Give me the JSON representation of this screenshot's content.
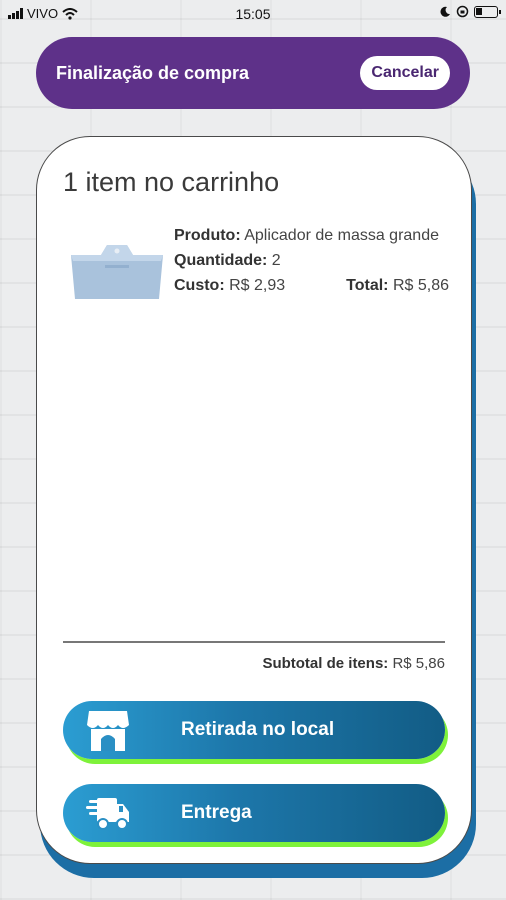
{
  "status_bar": {
    "carrier": "VIVO",
    "time": "15:05"
  },
  "header": {
    "title": "Finalização de compra",
    "cancel_label": "Cancelar"
  },
  "cart": {
    "title": "1 item no carrinho",
    "item": {
      "product_label": "Produto:",
      "product_value": "Aplicador de massa grande",
      "quantity_label": "Quantidade:",
      "quantity_value": "2",
      "cost_label": "Custo:",
      "cost_value": "R$ 2,93",
      "total_label": "Total:",
      "total_value": "R$ 5,86"
    },
    "subtotal_label": "Subtotal de itens:",
    "subtotal_value": "R$ 5,86"
  },
  "actions": {
    "pickup_label": "Retirada no local",
    "pickup_icon": "store-icon",
    "delivery_label": "Entrega",
    "delivery_icon": "delivery-truck-icon"
  },
  "colors": {
    "header_bg": "#5e3189",
    "button_gradient_start": "#2b9dd2",
    "button_gradient_end": "#125c85",
    "button_shadow": "#7ef23a",
    "card_shadow": "#1c6ea5"
  }
}
